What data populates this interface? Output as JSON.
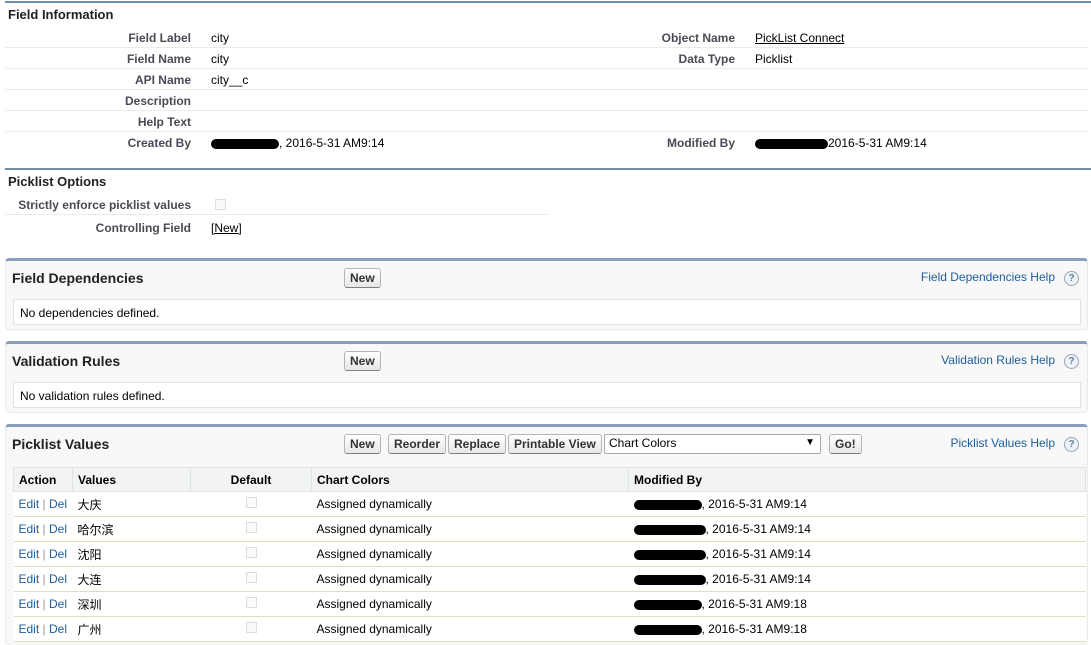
{
  "field_info": {
    "title": "Field Information",
    "rows": [
      {
        "label": "Field Label",
        "value": "city"
      },
      {
        "label": "Field Name",
        "value": "city"
      },
      {
        "label": "API Name",
        "value": "city__c"
      },
      {
        "label": "Description",
        "value": ""
      },
      {
        "label": "Help Text",
        "value": ""
      },
      {
        "label": "Created By",
        "value": ", 2016-5-31 AM9:14"
      }
    ],
    "object_name_label": "Object Name",
    "object_name_value": "PickList Connect",
    "data_type_label": "Data Type",
    "data_type_value": "Picklist",
    "modified_by_label": "Modified By",
    "modified_by_value": "2016-5-31 AM9:14"
  },
  "picklist_options": {
    "title": "Picklist Options",
    "strict_label": "Strictly enforce picklist values",
    "controlling_label": "Controlling Field",
    "controlling_link": "[New]"
  },
  "field_dependencies": {
    "title": "Field Dependencies",
    "new_label": "New",
    "help": "Field Dependencies Help",
    "empty": "No dependencies defined."
  },
  "validation_rules": {
    "title": "Validation Rules",
    "new_label": "New",
    "help": "Validation Rules Help",
    "empty": "No validation rules defined."
  },
  "picklist_values": {
    "title": "Picklist Values",
    "buttons": {
      "new": "New",
      "reorder": "Reorder",
      "replace": "Replace",
      "printable": "Printable View",
      "go": "Go!"
    },
    "select_value": "Chart Colors",
    "help": "Picklist Values Help",
    "headers": {
      "action": "Action",
      "values": "Values",
      "default": "Default",
      "chart_colors": "Chart Colors",
      "modified_by": "Modified By"
    },
    "edit_label": "Edit",
    "sep": "|",
    "del_label": "Del",
    "rows": [
      {
        "value": "大庆",
        "chart": "Assigned dynamically",
        "modified": ", 2016-5-31 AM9:14"
      },
      {
        "value": "哈尔滨",
        "chart": "Assigned dynamically",
        "modified": ", 2016-5-31 AM9:14"
      },
      {
        "value": "沈阳",
        "chart": "Assigned dynamically",
        "modified": ", 2016-5-31 AM9:14"
      },
      {
        "value": "大连",
        "chart": "Assigned dynamically",
        "modified": ", 2016-5-31 AM9:14"
      },
      {
        "value": "深圳",
        "chart": "Assigned dynamically",
        "modified": ", 2016-5-31 AM9:18"
      },
      {
        "value": "广州",
        "chart": "Assigned dynamically",
        "modified": ", 2016-5-31 AM9:18"
      }
    ]
  },
  "colors": {
    "accent": "#6f8fa9",
    "link": "#1f5c9a",
    "panel_bg": "#f8f8f8"
  }
}
